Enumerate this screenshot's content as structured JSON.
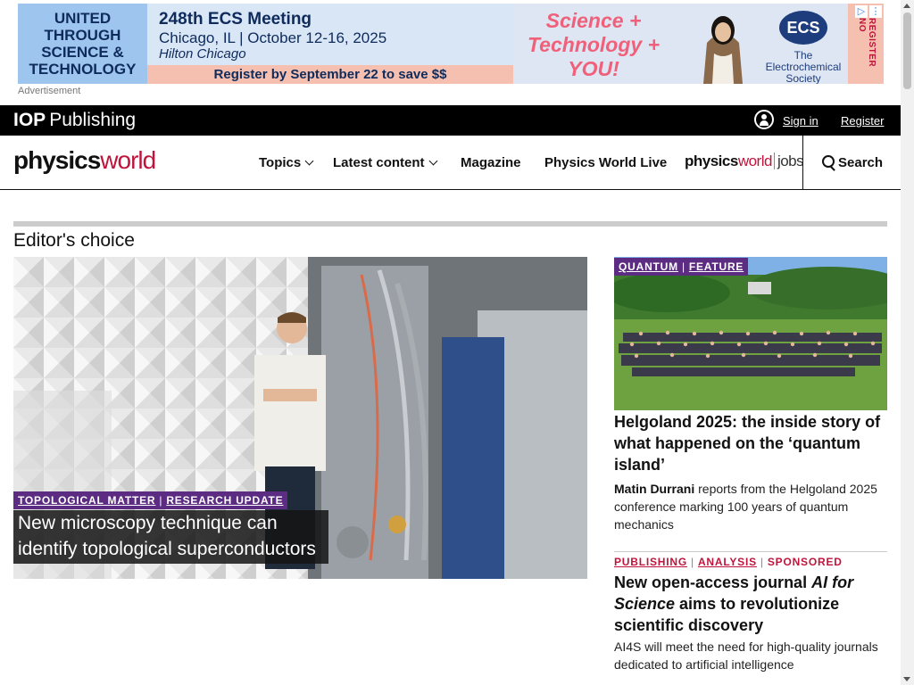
{
  "ad": {
    "left_text": "UNITED THROUGH SCIENCE & TECHNOLOGY",
    "meeting": "248th ECS Meeting",
    "location": "Chicago, IL | October 12-16, 2025",
    "venue": "Hilton Chicago",
    "register": "Register by September 22 to save $$",
    "slogan_line1": "Science +",
    "slogan_line2": "Technology +",
    "slogan_line3": "YOU!",
    "ecs_logo": "ECS",
    "ecs_name_line1": "The",
    "ecs_name_line2": "Electrochemical",
    "ecs_name_line3": "Society",
    "side_text": "REGISTER NO",
    "label": "Advertisement"
  },
  "iop": {
    "logo_bold": "IOP",
    "logo_rest": "Publishing",
    "sign_in": "Sign in",
    "register": "Register"
  },
  "nav": {
    "logo_physics": "physics",
    "logo_world": "world",
    "items": [
      "Topics",
      "Latest content",
      "Magazine",
      "Physics World Live"
    ],
    "jobs_physics": "physics",
    "jobs_world": "world",
    "jobs_jobs": "jobs",
    "search": "Search"
  },
  "section": {
    "title": "Editor's choice"
  },
  "hero": {
    "tag1": "TOPOLOGICAL MATTER",
    "tag2": "RESEARCH UPDATE",
    "title": "New microscopy technique can identify topological superconductors"
  },
  "article1": {
    "tag1": "QUANTUM",
    "tag2": "FEATURE",
    "title": "Helgoland 2025: the inside story of what happened on the ‘quantum island’",
    "author": "Matin Durrani",
    "desc": " reports from the Helgoland 2025 conference marking 100 years of quantum mechanics"
  },
  "article2": {
    "tag1": "PUBLISHING",
    "tag2": "ANALYSIS",
    "tag3": "SPONSORED",
    "title_pre": "New open-access journal ",
    "title_em": "AI for Science",
    "title_post": " aims to revolutionize scientific discovery",
    "desc": "AI4S will meet the need for high-quality journals dedicated to artificial intelligence"
  }
}
